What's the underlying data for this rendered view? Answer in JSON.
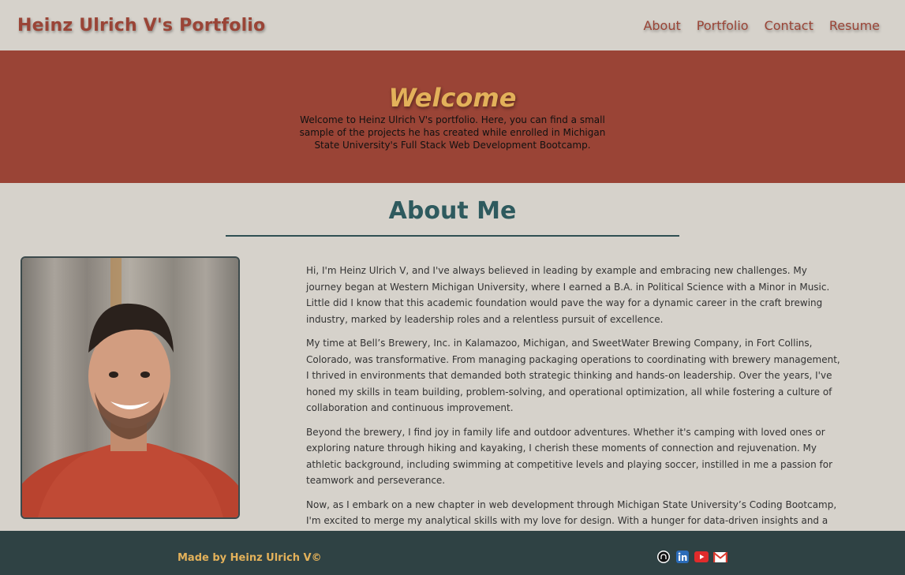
{
  "header": {
    "title": "Heinz Ulrich V's Portfolio",
    "nav": [
      "About",
      "Portfolio",
      "Contact",
      "Resume"
    ]
  },
  "hero": {
    "title": "Welcome",
    "text": "Welcome to Heinz Ulrich V's portfolio. Here, you can find a small sample of the projects he has created while enrolled in Michigan State University's Full Stack Web Development Bootcamp."
  },
  "about": {
    "heading": "About Me",
    "paragraphs": [
      "Hi, I'm Heinz Ulrich V, and I've always believed in leading by example and embracing new challenges. My journey began at Western Michigan University, where I earned a B.A. in Political Science with a Minor in Music. Little did I know that this academic foundation would pave the way for a dynamic career in the craft brewing industry, marked by leadership roles and a relentless pursuit of excellence.",
      "My time at Bell’s Brewery, Inc. in Kalamazoo, Michigan, and SweetWater Brewing Company, in Fort Collins, Colorado, was transformative. From managing packaging operations to coordinating with brewery management, I thrived in environments that demanded both strategic thinking and hands-on leadership. Over the years, I've honed my skills in team building, problem-solving, and operational optimization, all while fostering a culture of collaboration and continuous improvement.",
      "Beyond the brewery, I find joy in family life and outdoor adventures. Whether it's camping with loved ones or exploring nature through hiking and kayaking, I cherish these moments of connection and rejuvenation. My athletic background, including swimming at competitive levels and playing soccer, instilled in me a passion for teamwork and perseverance.",
      "Now, as I embark on a new chapter in web development through Michigan State University’s Coding Bootcamp, I'm excited to merge my analytical skills with my love for design. With a hunger for data-driven insights and a knack for problem-solving, I'm poised to make meaningful contributions to the digital landscape while continuing to embrace growth and learning."
    ]
  },
  "footer": {
    "credit": "Made by Heinz Ulrich V©",
    "icons": [
      "github-icon",
      "linkedin-icon",
      "youtube-icon",
      "gmail-icon"
    ]
  },
  "colors": {
    "brand_red": "#9a4436",
    "accent_gold": "#e3b15a",
    "teal": "#2e5a5e",
    "footer_bg": "#2f4244",
    "page_bg": "#d6d2cb"
  }
}
